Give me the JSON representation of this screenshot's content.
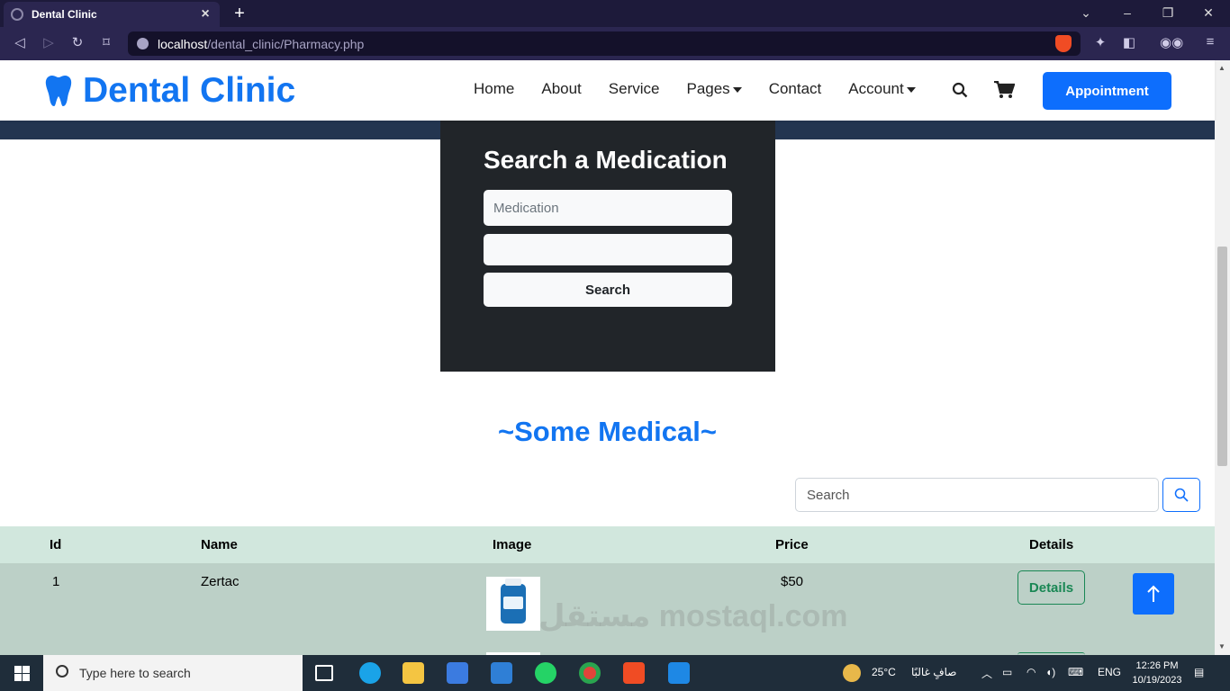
{
  "browser": {
    "tab_title": "Dental Clinic",
    "new_tab": "+",
    "url_host": "localhost",
    "url_path": "/dental_clinic/Pharmacy.php"
  },
  "site": {
    "logo_text": "Dental Clinic",
    "menu": [
      "Home",
      "About",
      "Service",
      "Pages",
      "Contact",
      "Account"
    ],
    "appointment_label": "Appointment"
  },
  "med_search": {
    "title": "Search a Medication",
    "medication_placeholder": "Medication",
    "second_field_value": "",
    "button_label": "Search"
  },
  "section": {
    "title": "~Some Medical~",
    "search_placeholder": "Search"
  },
  "table": {
    "headers": [
      "Id",
      "Name",
      "Image",
      "Price",
      "Details"
    ],
    "rows": [
      {
        "id": "1",
        "name": "Zertac",
        "price": "$50",
        "details_label": "Details"
      }
    ]
  },
  "watermark": "مستقل mostaql.com",
  "taskbar": {
    "search_placeholder": "Type here to search",
    "weather": "25°C",
    "weather_text": "صافٍ غالبًا",
    "lang": "ENG",
    "time": "12:26 PM",
    "date": "10/19/2023"
  },
  "colors": {
    "brand": "#1275f1",
    "primary": "#0d6efd",
    "panel": "#212529",
    "table_head": "#d1e7dd",
    "table_row": "#bcd0c7",
    "success": "#198754"
  }
}
